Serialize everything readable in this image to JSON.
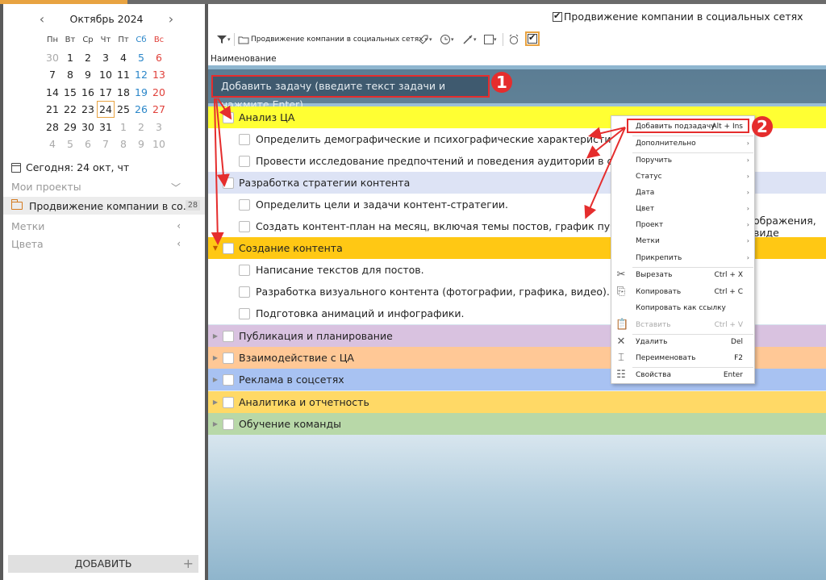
{
  "calendar": {
    "title": "Октябрь 2024",
    "prev": "‹",
    "next": "›",
    "weekdays": [
      "Пн",
      "Вт",
      "Ср",
      "Чт",
      "Пт",
      "Сб",
      "Вс"
    ],
    "weeks": [
      [
        "30",
        "1",
        "2",
        "3",
        "4",
        "5",
        "6"
      ],
      [
        "7",
        "8",
        "9",
        "10",
        "11",
        "12",
        "13"
      ],
      [
        "14",
        "15",
        "16",
        "17",
        "18",
        "19",
        "20"
      ],
      [
        "21",
        "22",
        "23",
        "24",
        "25",
        "26",
        "27"
      ],
      [
        "28",
        "29",
        "30",
        "31",
        "1",
        "2",
        "3"
      ],
      [
        "4",
        "5",
        "6",
        "7",
        "8",
        "9",
        "10"
      ]
    ]
  },
  "sidebar": {
    "today": "Сегодня: 24 окт, чт",
    "my_projects": "Мои проекты",
    "project_name": "Продвижение компании в со...",
    "project_count": "28",
    "tags": "Метки",
    "colors": "Цвета",
    "add_button": "ДОБАВИТЬ",
    "add_plus": "+"
  },
  "main": {
    "project_check_label": "Продвижение компании в социальных сетях",
    "toolbar_project": "Продвижение компании в социальных сетях",
    "column_header": "Наименование",
    "add_task_placeholder": "Добавить задачу (введите текст задачи и нажмите Enter).",
    "tasks": [
      {
        "label": "Анализ ЦА",
        "color": "#ffff33"
      },
      {
        "label": "Определить демографические и психографические характеристики целевой"
      },
      {
        "label": "Провести исследование предпочтений и поведения аудитории в социальных"
      },
      {
        "label": "Разработка стратегии контента",
        "color": "#dde3f5"
      },
      {
        "label": "Определить цели и задачи контент-стратегии."
      },
      {
        "label": "Создать контент-план на месяц, включая темы постов, график публикаций и"
      },
      {
        "label": "Создание контента",
        "color": "#ffc814"
      },
      {
        "label": "Написание текстов для постов."
      },
      {
        "label": "Разработка визуального контента (фотографии, графика, видео)."
      },
      {
        "label": "Подготовка анимаций и инфографики."
      },
      {
        "label": "Публикация и планирование",
        "color": "#d9c2e0"
      },
      {
        "label": "Взаимодействие с ЦА",
        "color": "#ffc896"
      },
      {
        "label": "Реклама в соцсетях",
        "color": "#a8c2f2"
      },
      {
        "label": "Аналитика и отчетность",
        "color": "#ffd966"
      },
      {
        "label": "Обучение команды",
        "color": "#b8d8a8"
      }
    ],
    "overflow_text": "ображения, виде"
  },
  "context_menu": {
    "items": [
      {
        "label": "Добавить подзадачу",
        "shortcut": "Alt + Ins"
      },
      {
        "label": "Дополнительно",
        "arrow": "›"
      },
      {
        "label": "Поручить",
        "arrow": "›"
      },
      {
        "label": "Статус",
        "arrow": "›"
      },
      {
        "label": "Дата",
        "arrow": "›"
      },
      {
        "label": "Цвет",
        "arrow": "›"
      },
      {
        "label": "Проект",
        "arrow": "›"
      },
      {
        "label": "Метки",
        "arrow": "›"
      },
      {
        "label": "Прикрепить",
        "arrow": "›"
      },
      {
        "label": "Вырезать",
        "shortcut": "Ctrl + X"
      },
      {
        "label": "Копировать",
        "shortcut": "Ctrl + C"
      },
      {
        "label": "Копировать как ссылку"
      },
      {
        "label": "Вставить",
        "shortcut": "Ctrl + V"
      },
      {
        "label": "Удалить",
        "shortcut": "Del"
      },
      {
        "label": "Переименовать",
        "shortcut": "F2"
      },
      {
        "label": "Свойства",
        "shortcut": "Enter"
      }
    ]
  },
  "badges": {
    "one": "1",
    "two": "2"
  },
  "colors": {
    "accent": "#e8a341",
    "annotation_red": "#e52d2d"
  }
}
